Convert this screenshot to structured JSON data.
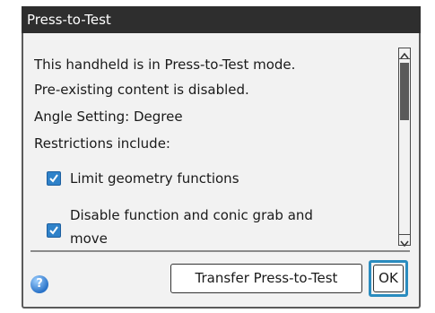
{
  "dialog": {
    "title": "Press-to-Test",
    "lines": [
      "This handheld is in Press-to-Test mode.",
      "Pre-existing content is disabled.",
      "Angle Setting: Degree",
      "Restrictions include:"
    ],
    "restrictions": [
      {
        "label": "Limit geometry functions",
        "checked": true
      },
      {
        "label_line1": "Disable function and conic grab and",
        "label_line2": "move",
        "checked": true
      }
    ],
    "help_icon": "help-icon",
    "transfer_label": "Transfer Press-to-Test",
    "ok_label": "OK"
  },
  "colors": {
    "titlebar": "#2e2e2e",
    "checkbox": "#2f82c9",
    "focus_ring": "#2a8cbf"
  }
}
